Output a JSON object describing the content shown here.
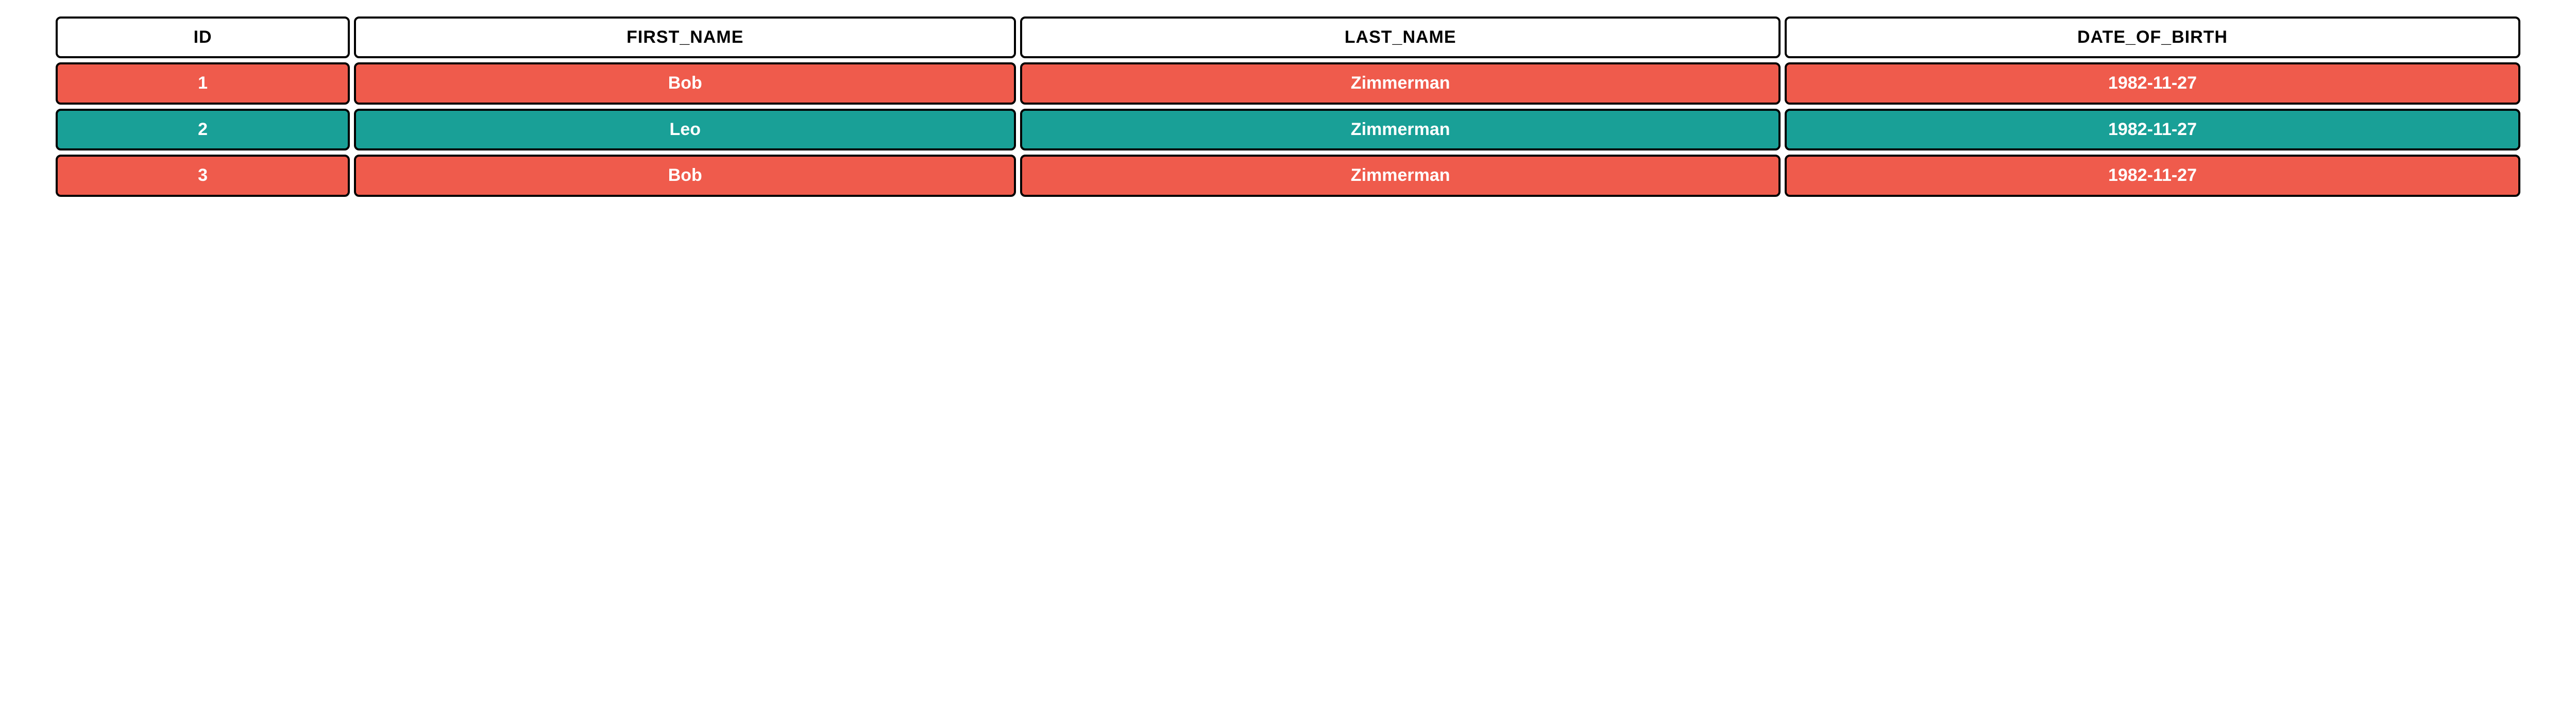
{
  "table": {
    "headers": {
      "id": "ID",
      "first_name": "FIRST_NAME",
      "last_name": "LAST_NAME",
      "date_of_birth": "DATE_OF_BIRTH"
    },
    "rows": [
      {
        "id": "1",
        "first_name": "Bob",
        "last_name": "Zimmerman",
        "date_of_birth": "1982-11-27",
        "color": "red"
      },
      {
        "id": "2",
        "first_name": "Leo",
        "last_name": "Zimmerman",
        "date_of_birth": "1982-11-27",
        "color": "teal"
      },
      {
        "id": "3",
        "first_name": "Bob",
        "last_name": "Zimmerman",
        "date_of_birth": "1982-11-27",
        "color": "red"
      }
    ]
  },
  "colors": {
    "red": "#ef5b4c",
    "teal": "#19a097",
    "border": "#000000",
    "header_bg": "#ffffff",
    "header_fg": "#000000",
    "cell_fg": "#ffffff"
  }
}
